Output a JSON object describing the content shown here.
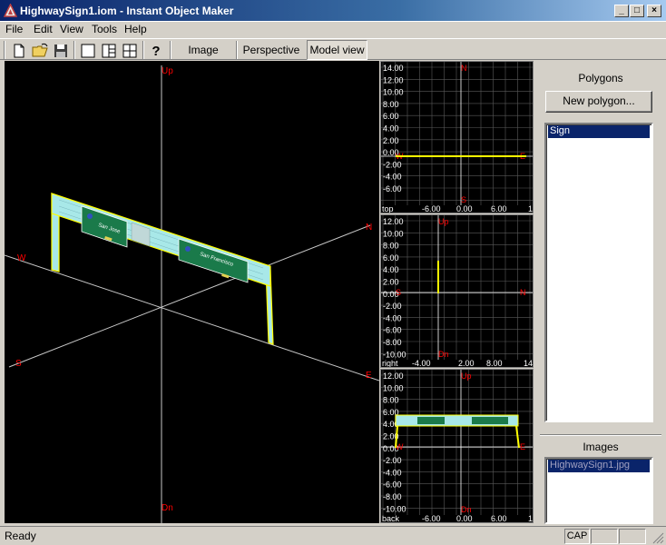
{
  "window": {
    "title": "HighwaySign1.iom - Instant Object Maker",
    "btn_minimize": "_",
    "btn_maximize": "□",
    "btn_close": "×"
  },
  "menu": [
    "File",
    "Edit",
    "View",
    "Tools",
    "Help"
  ],
  "toolbar": {
    "icons": [
      "new-file-icon",
      "open-folder-icon",
      "save-icon",
      "single-view-icon",
      "split-view-icon",
      "quad-view-icon",
      "help-icon"
    ],
    "tabs": [
      "Image",
      "Perspective",
      "Model view"
    ],
    "active_tab": "Model view"
  },
  "main_view": {
    "axis_labels": {
      "up": "Up",
      "dn": "Dn",
      "w": "W",
      "n": "N",
      "s": "S",
      "e": "E"
    },
    "sign_texts": [
      "San Jose",
      "San Francisco"
    ]
  },
  "views": {
    "top": {
      "name": "top",
      "y_ticks": [
        "14.00",
        "12.00",
        "10.00",
        "8.00",
        "6.00",
        "4.00",
        "2.00",
        "0.00",
        "-2.00",
        "-4.00",
        "-6.00"
      ],
      "x_ticks": [
        "-6.00",
        "0.00",
        "6.00",
        "1"
      ],
      "axis_labels": {
        "top": "N",
        "bottom": "S",
        "left": "W",
        "right": "E"
      }
    },
    "right": {
      "name": "right",
      "y_ticks": [
        "12.00",
        "10.00",
        "8.00",
        "6.00",
        "4.00",
        "2.00",
        "0.00",
        "-2.00",
        "-4.00",
        "-6.00",
        "-8.00",
        "-10.00"
      ],
      "x_ticks": [
        "-4.00",
        "2.00",
        "8.00",
        "14"
      ],
      "axis_labels": {
        "top": "Up",
        "bottom": "Dn",
        "left": "S",
        "right": "N"
      }
    },
    "back": {
      "name": "back",
      "y_ticks": [
        "12.00",
        "10.00",
        "8.00",
        "6.00",
        "4.00",
        "2.00",
        "0.00",
        "-2.00",
        "-4.00",
        "-6.00",
        "-8.00",
        "-10.00"
      ],
      "x_ticks": [
        "-6.00",
        "0.00",
        "6.00",
        "1"
      ],
      "axis_labels": {
        "top": "Up",
        "bottom": "Dn",
        "left": "W",
        "right": "E"
      }
    }
  },
  "panel": {
    "polygons_label": "Polygons",
    "new_polygon_button": "New polygon...",
    "polygons": [
      "Sign"
    ],
    "images_label": "Images",
    "images": [
      "HighwaySign1.jpg"
    ]
  },
  "status": {
    "text": "Ready",
    "cap": "CAP"
  },
  "colors": {
    "accent_yellow": "#ffff00",
    "selection_blue": "#0a246a",
    "axis_red": "#ff0000",
    "sign_cyan": "#a8e8e8",
    "sign_green": "#1a7a4a"
  }
}
